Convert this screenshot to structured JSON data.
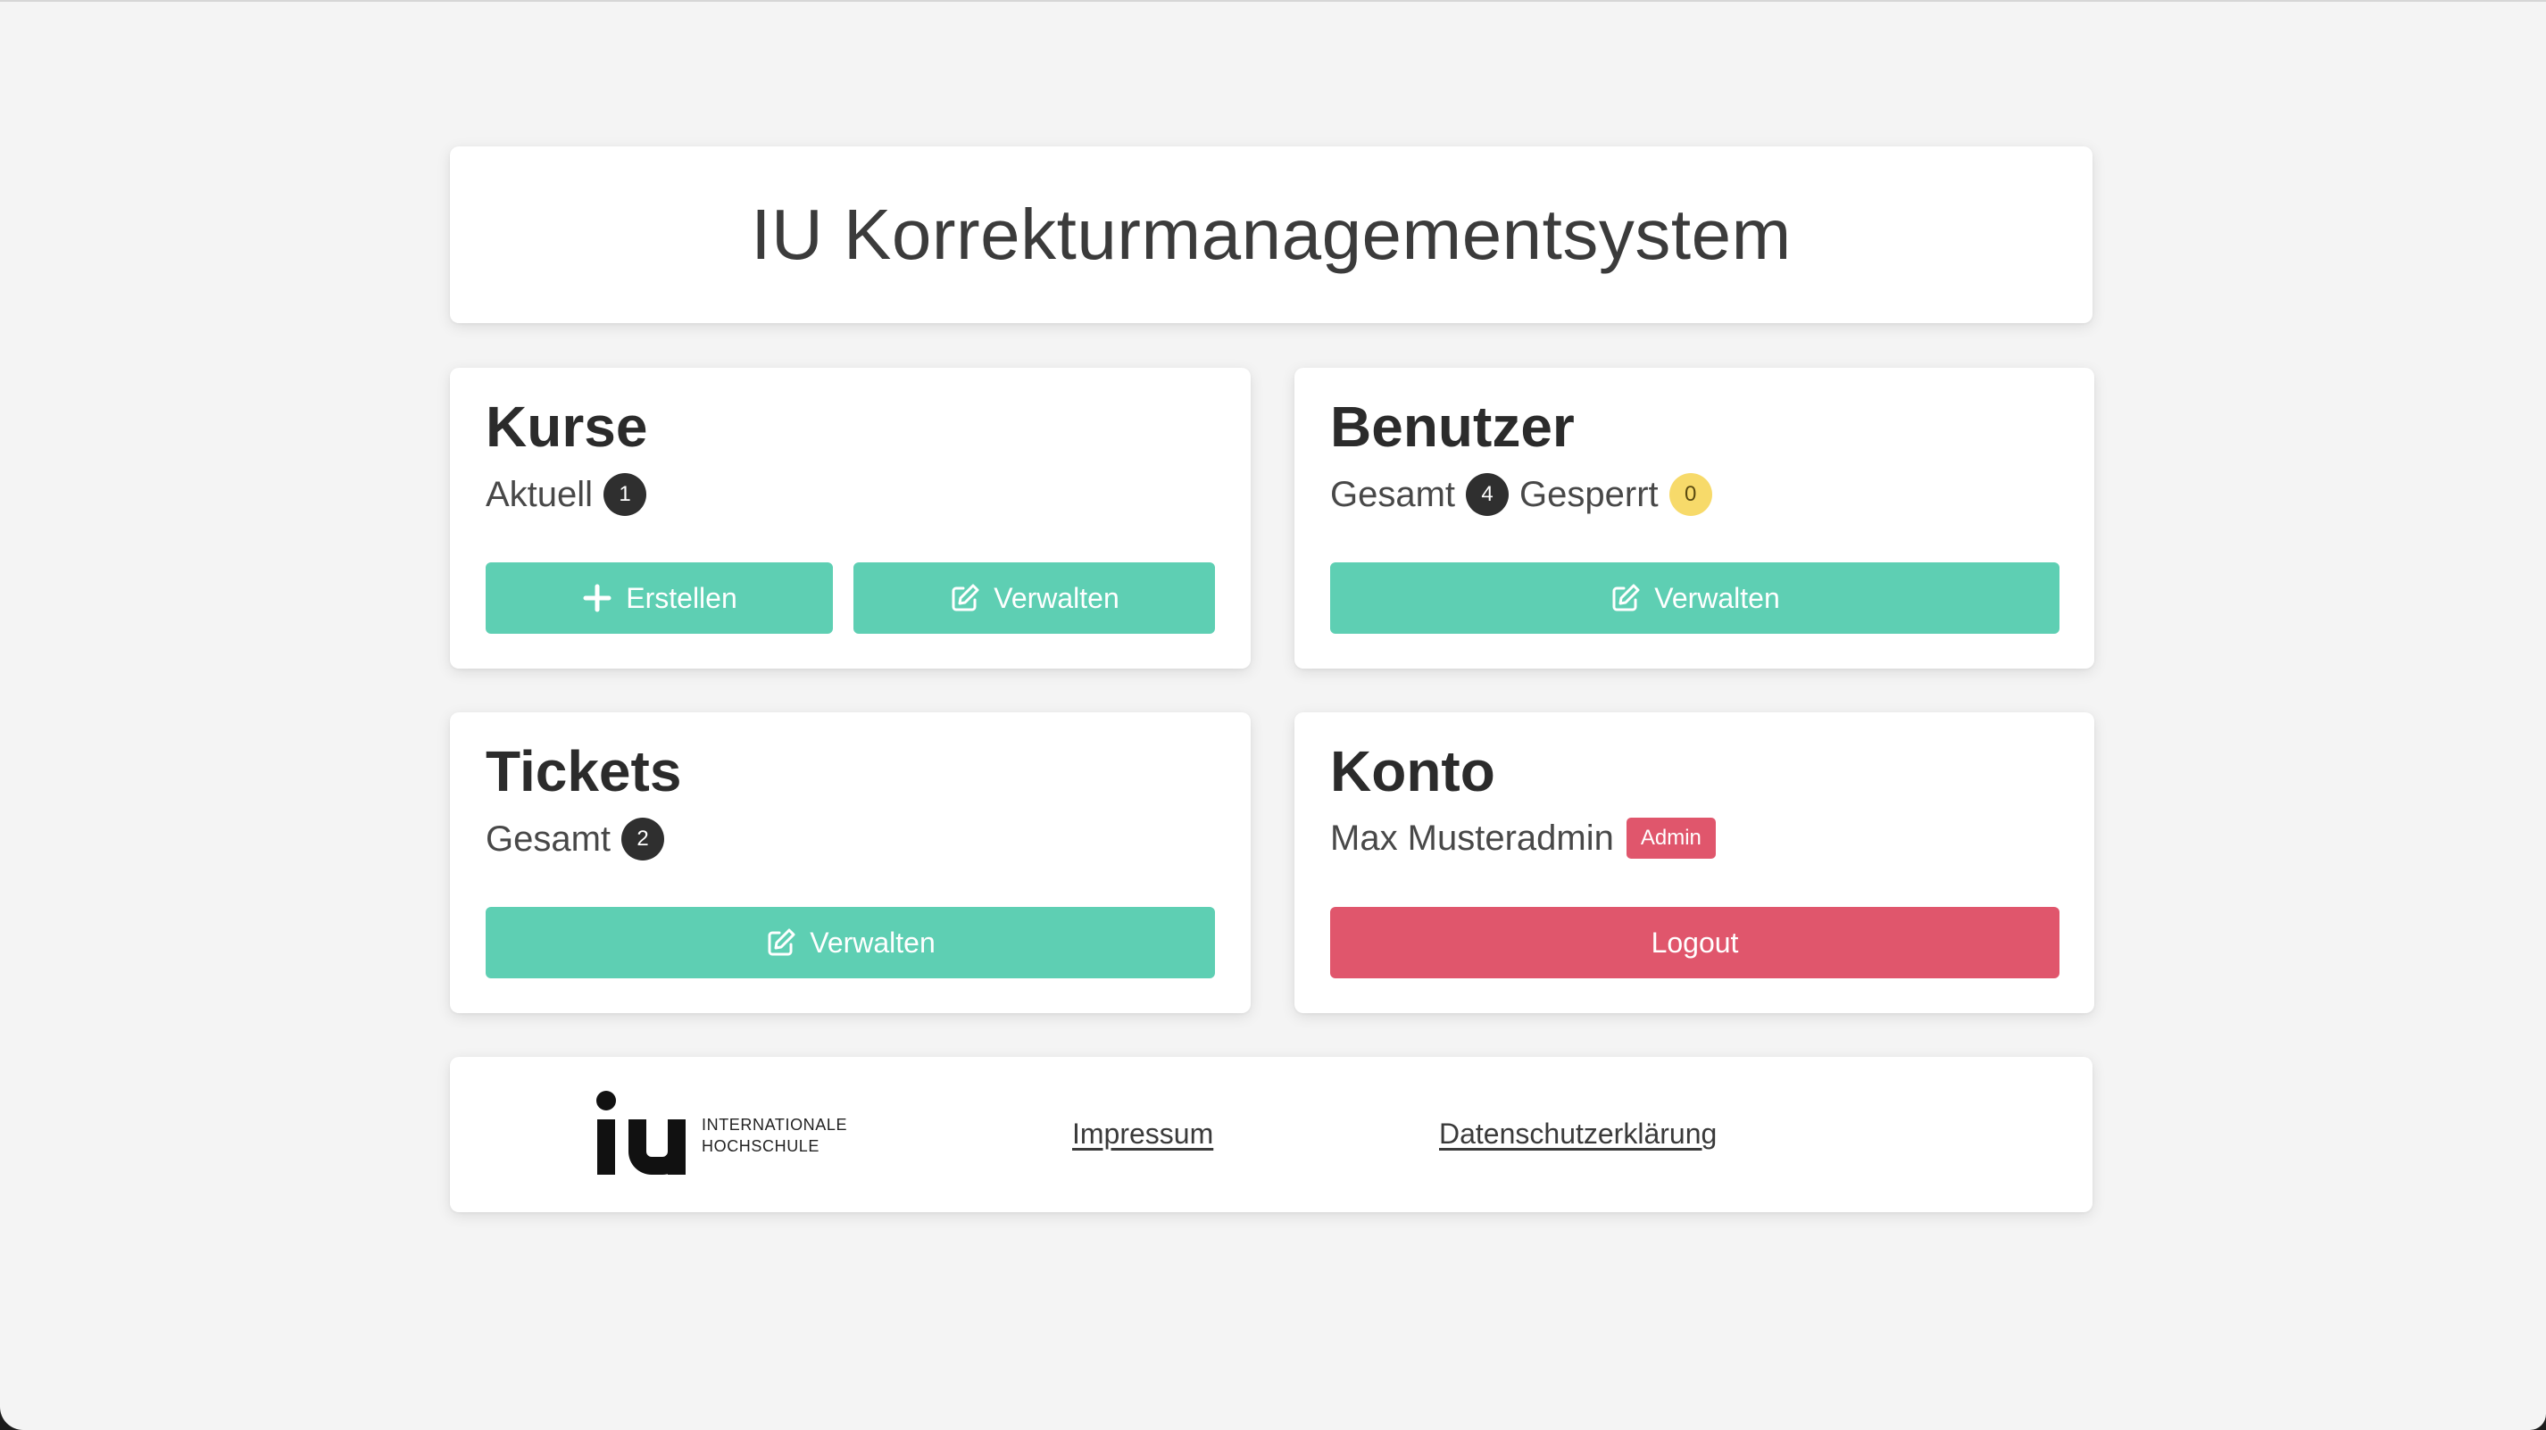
{
  "app": {
    "title": "IU Korrekturmanagementsystem"
  },
  "colors": {
    "background": "#f4f4f4",
    "primary_button": "#5ecfb3",
    "danger_button": "#e0566c",
    "dark_badge": "#2f2f2f",
    "warning_badge": "#f7da6a"
  },
  "kurse": {
    "title": "Kurse",
    "stat_label": "Aktuell",
    "stat_value": "1",
    "create_button": {
      "label": "Erstellen",
      "icon": "plus-icon"
    },
    "manage_button": {
      "label": "Verwalten",
      "icon": "edit-icon"
    }
  },
  "benutzer": {
    "title": "Benutzer",
    "total_label": "Gesamt",
    "total_value": "4",
    "blocked_label": "Gesperrt",
    "blocked_value": "0",
    "manage_button": {
      "label": "Verwalten",
      "icon": "edit-icon"
    }
  },
  "tickets": {
    "title": "Tickets",
    "total_label": "Gesamt",
    "total_value": "2",
    "manage_button": {
      "label": "Verwalten",
      "icon": "edit-icon"
    }
  },
  "konto": {
    "title": "Konto",
    "user_name": "Max Musteradmin",
    "role": "Admin",
    "logout_button": {
      "label": "Logout"
    }
  },
  "footer": {
    "logo_line1": "INTERNATIONALE",
    "logo_line2": "HOCHSCHULE",
    "impressum": "Impressum",
    "datenschutz": "Datenschutzerklärung"
  }
}
